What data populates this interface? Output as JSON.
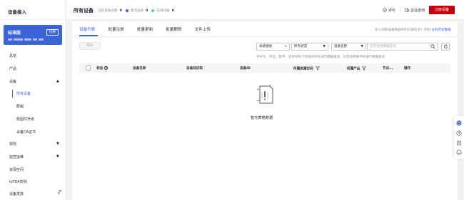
{
  "sidebar": {
    "title": "设备接入",
    "edition": {
      "name": "标准版",
      "switch_label": "切换"
    },
    "items": [
      {
        "label": "总览"
      },
      {
        "label": "产品"
      },
      {
        "label": "设备",
        "chevron": "▲"
      },
      {
        "label": "所有设备"
      },
      {
        "label": "群组"
      },
      {
        "label": "软固件升级"
      },
      {
        "label": "设备CA证书"
      },
      {
        "label": "规则",
        "chevron": "▼"
      },
      {
        "label": "监控运维",
        "chevron": "▼"
      },
      {
        "label": "资源空间"
      },
      {
        "label": "IoTDA实例"
      },
      {
        "label": "设备发放"
      }
    ],
    "active_item": "所有设备"
  },
  "header": {
    "title": "所有设备",
    "stats": {
      "total_label": "当前设备总数",
      "total_value": "0",
      "active_label": "激活设备",
      "active_value": "0",
      "online_label": "在线设备",
      "online_value": "0"
    },
    "rating_label": "评价",
    "consult_label": "企业咨询",
    "register_label": "注册设备"
  },
  "tabs": {
    "items": [
      "设备列表",
      "批量注册",
      "批量更新",
      "批量删除",
      "文件上传"
    ],
    "active": "设备列表",
    "hint": "深入洞察设备数据中的价值信息？开始",
    "hint_link": "分析历史数据"
  },
  "toolbar": {
    "delete_label": "删除",
    "advanced_search": "高级搜索",
    "status_select": "所有状态",
    "field_select": "设备名称",
    "search_placeholder": "支持名称模糊查询",
    "search_hint": "对中文、字母、数字、连字符和下划线的字符进行模糊查询，对其他特殊字符进行精确查询"
  },
  "table": {
    "columns": [
      "状态",
      "设备名称",
      "设备标识码",
      "设备ID",
      "所属资源空间",
      "所属产品",
      "节点...",
      "操作"
    ],
    "rows": [],
    "empty_text": "暂无表格数据"
  },
  "colors": {
    "brand": "#3c64d9",
    "register": "#c7000b",
    "online_dot": "#50d4ab"
  },
  "icons": [
    "smile-icon",
    "building-icon",
    "search-icon",
    "refresh-icon",
    "help-icon",
    "filter-icon",
    "empty-doc-icon",
    "link-icon",
    "chat-icon",
    "question-icon",
    "edit-icon",
    "emoji-icon"
  ]
}
